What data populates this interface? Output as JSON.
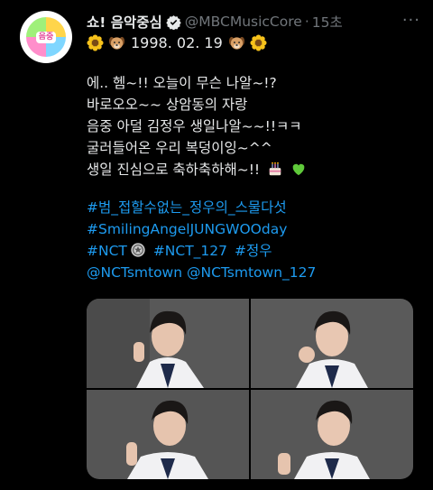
{
  "account": {
    "name": "쇼! 음악중심",
    "handle": "@MBCMusicCore",
    "time": "15초",
    "avatar_text": "음중"
  },
  "subline": {
    "date": "1998. 02. 19"
  },
  "tweet": {
    "lines": [
      "에.. 헴~!! 오늘이 무슨 나알~!?",
      "바로오오~~ 상암동의 자랑",
      "음중 아덜 김정우 생일나알~~!!ㅋㅋ",
      "굴러들어온 우리 복덩이잉~^^",
      "생일 진심으로 축하축하해~!!"
    ],
    "hashtag1": "#범_접할수없는_정우의_스물다섯",
    "hashtag2": "#SmilingAngelJUNGWOOday",
    "hashtag3a": "#NCT",
    "hashtag3b": "#NCT_127",
    "hashtag3c": "#정우",
    "mentions": "@NCTsmtown @NCTsmtown_127"
  },
  "icons": [
    "verified-badge-icon",
    "sunflower-icon",
    "puppy-icon",
    "cake-icon",
    "green-heart-icon",
    "nct-emblem-icon",
    "more-icon"
  ],
  "colors": {
    "link": "#1d9bf0",
    "muted": "#71767b",
    "text": "#e7e9ea",
    "background": "#000000"
  }
}
